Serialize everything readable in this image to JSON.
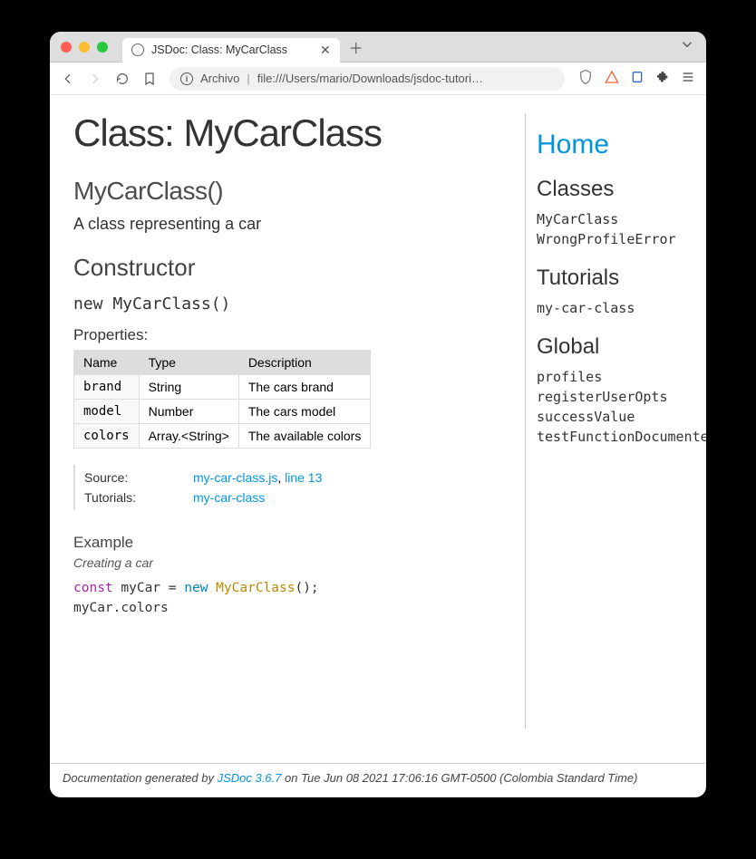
{
  "browser": {
    "tab_title": "JSDoc: Class: MyCarClass",
    "url_label": "Archivo",
    "url_path": "file:///Users/mario/Downloads/jsdoc-tutori…"
  },
  "page": {
    "title": "Class: MyCarClass",
    "class_signature": "MyCarClass()",
    "description": "A class representing a car",
    "constructor_heading": "Constructor",
    "constructor_signature": "new MyCarClass()",
    "properties_heading": "Properties:",
    "properties": {
      "headers": {
        "name": "Name",
        "type": "Type",
        "description": "Description"
      },
      "rows": [
        {
          "name": "brand",
          "type": "String",
          "description": "The cars brand"
        },
        {
          "name": "model",
          "type": "Number",
          "description": "The cars model"
        },
        {
          "name": "colors",
          "type": "Array.<String>",
          "description": "The available colors"
        }
      ]
    },
    "details": {
      "source_label": "Source:",
      "source_file": "my-car-class.js",
      "source_line": "line 13",
      "tutorials_label": "Tutorials:",
      "tutorial_link": "my-car-class"
    },
    "example": {
      "heading": "Example",
      "caption": "Creating a car",
      "code": {
        "kw_const": "const",
        "var": " myCar = ",
        "kw_new": "new",
        "cls": " MyCarClass",
        "parens": "();",
        "line2": "myCar.colors"
      }
    }
  },
  "sidebar": {
    "home": "Home",
    "classes_heading": "Classes",
    "classes": [
      "MyCarClass",
      "WrongProfileError"
    ],
    "tutorials_heading": "Tutorials",
    "tutorials": [
      "my-car-class"
    ],
    "global_heading": "Global",
    "globals": [
      "profiles",
      "registerUserOpts",
      "successValue",
      "testFunctionDocumented"
    ]
  },
  "footer": {
    "prefix": "Documentation generated by ",
    "link": "JSDoc 3.6.7",
    "suffix": " on Tue Jun 08 2021 17:06:16 GMT-0500 (Colombia Standard Time)"
  }
}
